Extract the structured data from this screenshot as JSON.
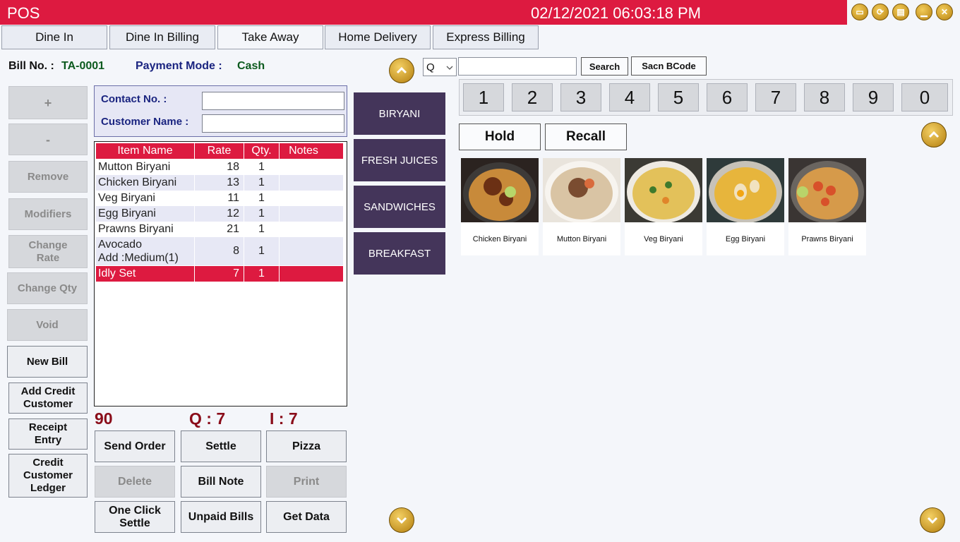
{
  "app": {
    "title": "POS",
    "datetime": "02/12/2021 06:03:18 PM"
  },
  "window_controls": [
    {
      "name": "print-icon",
      "glyph": "▭"
    },
    {
      "name": "refresh-icon",
      "glyph": "⟳"
    },
    {
      "name": "keyboard-icon",
      "glyph": "▤"
    },
    {
      "name": "minimize-icon",
      "glyph": "▁"
    },
    {
      "name": "close-icon",
      "glyph": "✕"
    }
  ],
  "tabs": [
    "Dine In",
    "Dine In Billing",
    "Take Away",
    "Home Delivery",
    "Express Billing"
  ],
  "active_tab": "Take Away",
  "bill": {
    "bill_no_label": "Bill No. :",
    "bill_no": "TA-0001",
    "payment_mode_label": "Payment Mode :",
    "payment_mode": "Cash"
  },
  "left_actions": [
    "+",
    "-",
    "Remove",
    "Modifiers",
    "Change Rate",
    "Change Qty",
    "Void",
    "New Bill",
    "Add Credit Customer",
    "Receipt Entry",
    "Credit Customer Ledger"
  ],
  "customer": {
    "contact_label": "Contact No. :",
    "contact_value": "",
    "name_label": "Customer Name :",
    "name_value": ""
  },
  "items_table": {
    "columns": [
      "Item Name",
      "Rate",
      "Qty.",
      "Notes"
    ],
    "rows": [
      {
        "name": "Mutton Biryani",
        "rate": "18",
        "qty": "1",
        "notes": ""
      },
      {
        "name": "Chicken Biryani",
        "rate": "13",
        "qty": "1",
        "notes": ""
      },
      {
        "name": "Veg Biryani",
        "rate": "11",
        "qty": "1",
        "notes": ""
      },
      {
        "name": "Egg Biryani",
        "rate": "12",
        "qty": "1",
        "notes": ""
      },
      {
        "name": "Prawns Biryani",
        "rate": "21",
        "qty": "1",
        "notes": ""
      },
      {
        "name": "Avocado",
        "name2": "Add :Medium(1)",
        "rate": "8",
        "qty": "1",
        "notes": ""
      },
      {
        "name": "Idly Set",
        "rate": "7",
        "qty": "1",
        "notes": "",
        "selected": true
      }
    ]
  },
  "totals": {
    "amount": "90",
    "qty": "Q : 7",
    "items": "I : 7"
  },
  "bottom_actions": [
    "Send Order",
    "Settle",
    "Pizza",
    "Delete",
    "Bill Note",
    "Print",
    "One Click Settle",
    "Unpaid Bills",
    "Get Data"
  ],
  "categories": [
    "BIRYANI",
    "FRESH JUICES",
    "SANDWICHES",
    "BREAKFAST"
  ],
  "search": {
    "mode": "Q",
    "value": "",
    "search_label": "Search",
    "barcode_label": "Sacn BCode"
  },
  "numpad": [
    "1",
    "2",
    "3",
    "4",
    "5",
    "6",
    "7",
    "8",
    "9",
    "0"
  ],
  "hold_label": "Hold",
  "recall_label": "Recall",
  "products": [
    {
      "name": "Chicken Biryani",
      "rice": "#c88a3a",
      "top": "#6b3014"
    },
    {
      "name": "Mutton Biryani",
      "rice": "#d9c4a4",
      "top": "#7a4c30"
    },
    {
      "name": "Veg Biryani",
      "rice": "#e3c15a",
      "top": "#3f7a2c"
    },
    {
      "name": "Egg Biryani",
      "rice": "#e7b53c",
      "top": "#f1e2c0"
    },
    {
      "name": "Prawns Biryani",
      "rice": "#d69a4a",
      "top": "#d8512a"
    }
  ],
  "colors": {
    "accent_red": "#dd1a40",
    "category_purple": "#44355a",
    "gold": "#c9951a"
  }
}
